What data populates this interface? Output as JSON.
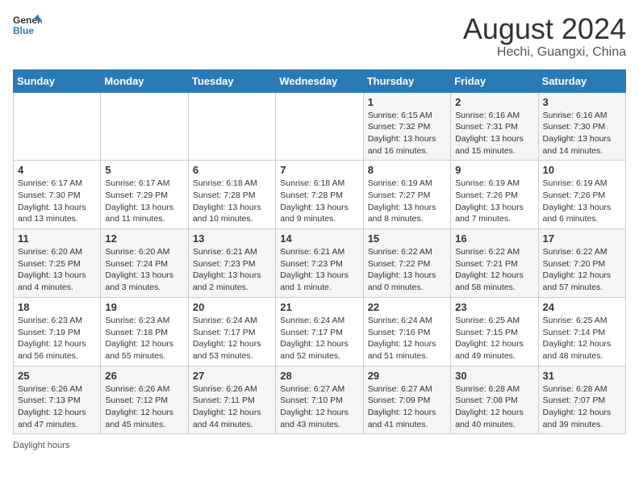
{
  "header": {
    "logo": {
      "text_general": "General",
      "text_blue": "Blue"
    },
    "title": "August 2024",
    "location": "Hechi, Guangxi, China"
  },
  "weekdays": [
    "Sunday",
    "Monday",
    "Tuesday",
    "Wednesday",
    "Thursday",
    "Friday",
    "Saturday"
  ],
  "weeks": [
    [
      {
        "num": "",
        "info": ""
      },
      {
        "num": "",
        "info": ""
      },
      {
        "num": "",
        "info": ""
      },
      {
        "num": "",
        "info": ""
      },
      {
        "num": "1",
        "info": "Sunrise: 6:15 AM\nSunset: 7:32 PM\nDaylight: 13 hours and 16 minutes."
      },
      {
        "num": "2",
        "info": "Sunrise: 6:16 AM\nSunset: 7:31 PM\nDaylight: 13 hours and 15 minutes."
      },
      {
        "num": "3",
        "info": "Sunrise: 6:16 AM\nSunset: 7:30 PM\nDaylight: 13 hours and 14 minutes."
      }
    ],
    [
      {
        "num": "4",
        "info": "Sunrise: 6:17 AM\nSunset: 7:30 PM\nDaylight: 13 hours and 13 minutes."
      },
      {
        "num": "5",
        "info": "Sunrise: 6:17 AM\nSunset: 7:29 PM\nDaylight: 13 hours and 11 minutes."
      },
      {
        "num": "6",
        "info": "Sunrise: 6:18 AM\nSunset: 7:28 PM\nDaylight: 13 hours and 10 minutes."
      },
      {
        "num": "7",
        "info": "Sunrise: 6:18 AM\nSunset: 7:28 PM\nDaylight: 13 hours and 9 minutes."
      },
      {
        "num": "8",
        "info": "Sunrise: 6:19 AM\nSunset: 7:27 PM\nDaylight: 13 hours and 8 minutes."
      },
      {
        "num": "9",
        "info": "Sunrise: 6:19 AM\nSunset: 7:26 PM\nDaylight: 13 hours and 7 minutes."
      },
      {
        "num": "10",
        "info": "Sunrise: 6:19 AM\nSunset: 7:26 PM\nDaylight: 13 hours and 6 minutes."
      }
    ],
    [
      {
        "num": "11",
        "info": "Sunrise: 6:20 AM\nSunset: 7:25 PM\nDaylight: 13 hours and 4 minutes."
      },
      {
        "num": "12",
        "info": "Sunrise: 6:20 AM\nSunset: 7:24 PM\nDaylight: 13 hours and 3 minutes."
      },
      {
        "num": "13",
        "info": "Sunrise: 6:21 AM\nSunset: 7:23 PM\nDaylight: 13 hours and 2 minutes."
      },
      {
        "num": "14",
        "info": "Sunrise: 6:21 AM\nSunset: 7:23 PM\nDaylight: 13 hours and 1 minute."
      },
      {
        "num": "15",
        "info": "Sunrise: 6:22 AM\nSunset: 7:22 PM\nDaylight: 13 hours and 0 minutes."
      },
      {
        "num": "16",
        "info": "Sunrise: 6:22 AM\nSunset: 7:21 PM\nDaylight: 12 hours and 58 minutes."
      },
      {
        "num": "17",
        "info": "Sunrise: 6:22 AM\nSunset: 7:20 PM\nDaylight: 12 hours and 57 minutes."
      }
    ],
    [
      {
        "num": "18",
        "info": "Sunrise: 6:23 AM\nSunset: 7:19 PM\nDaylight: 12 hours and 56 minutes."
      },
      {
        "num": "19",
        "info": "Sunrise: 6:23 AM\nSunset: 7:18 PM\nDaylight: 12 hours and 55 minutes."
      },
      {
        "num": "20",
        "info": "Sunrise: 6:24 AM\nSunset: 7:17 PM\nDaylight: 12 hours and 53 minutes."
      },
      {
        "num": "21",
        "info": "Sunrise: 6:24 AM\nSunset: 7:17 PM\nDaylight: 12 hours and 52 minutes."
      },
      {
        "num": "22",
        "info": "Sunrise: 6:24 AM\nSunset: 7:16 PM\nDaylight: 12 hours and 51 minutes."
      },
      {
        "num": "23",
        "info": "Sunrise: 6:25 AM\nSunset: 7:15 PM\nDaylight: 12 hours and 49 minutes."
      },
      {
        "num": "24",
        "info": "Sunrise: 6:25 AM\nSunset: 7:14 PM\nDaylight: 12 hours and 48 minutes."
      }
    ],
    [
      {
        "num": "25",
        "info": "Sunrise: 6:26 AM\nSunset: 7:13 PM\nDaylight: 12 hours and 47 minutes."
      },
      {
        "num": "26",
        "info": "Sunrise: 6:26 AM\nSunset: 7:12 PM\nDaylight: 12 hours and 45 minutes."
      },
      {
        "num": "27",
        "info": "Sunrise: 6:26 AM\nSunset: 7:11 PM\nDaylight: 12 hours and 44 minutes."
      },
      {
        "num": "28",
        "info": "Sunrise: 6:27 AM\nSunset: 7:10 PM\nDaylight: 12 hours and 43 minutes."
      },
      {
        "num": "29",
        "info": "Sunrise: 6:27 AM\nSunset: 7:09 PM\nDaylight: 12 hours and 41 minutes."
      },
      {
        "num": "30",
        "info": "Sunrise: 6:28 AM\nSunset: 7:08 PM\nDaylight: 12 hours and 40 minutes."
      },
      {
        "num": "31",
        "info": "Sunrise: 6:28 AM\nSunset: 7:07 PM\nDaylight: 12 hours and 39 minutes."
      }
    ]
  ],
  "footer": {
    "note": "Daylight hours"
  }
}
